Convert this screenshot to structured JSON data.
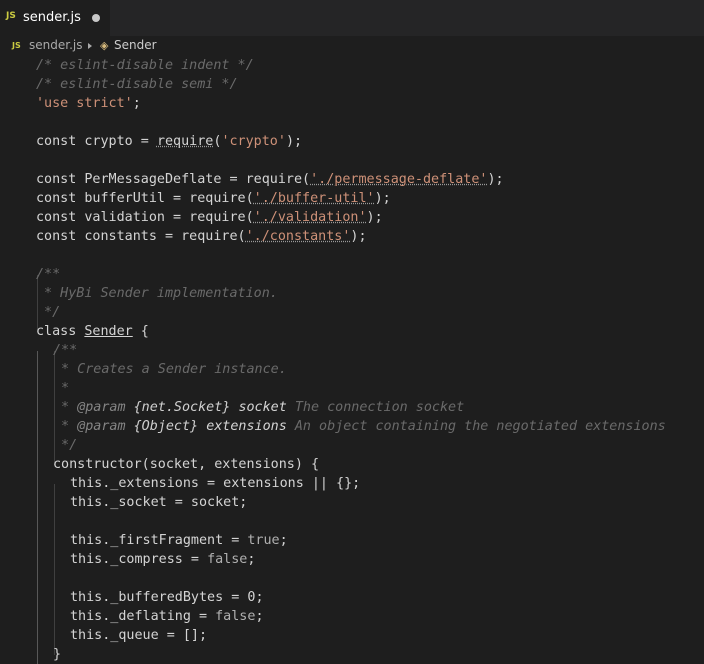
{
  "tab": {
    "icon": "JS",
    "filename": "sender.js"
  },
  "breadcrumb": {
    "icon": "JS",
    "file": "sender.js",
    "symbol_icon": "class-icon",
    "symbol": "Sender"
  },
  "code": {
    "l1": "/* eslint-disable indent */",
    "l2": "/* eslint-disable semi */",
    "l3_str": "'use strict'",
    "l5_a": "const crypto = ",
    "l5_req": "require",
    "l5_b": "(",
    "l5_str": "'crypto'",
    "l5_c": ");",
    "l7_a": "const PerMessageDeflate = require(",
    "l7_str": "'./permessage-deflate'",
    "l7_c": ");",
    "l8_a": "const bufferUtil = require(",
    "l8_str": "'./buffer-util'",
    "l8_c": ");",
    "l9_a": "const validation = require(",
    "l9_str": "'./validation'",
    "l9_c": ");",
    "l10_a": "const constants = require(",
    "l10_str": "'./constants'",
    "l10_c": ");",
    "l12": "/**",
    "l13": " * HyBi Sender implementation.",
    "l14": " */",
    "l15_a": "class ",
    "l15_name": "Sender",
    "l15_b": " {",
    "l16": "/**",
    "l17": " * Creates a Sender instance.",
    "l18": " *",
    "l19_star": " * ",
    "l19_tag": "@param",
    "l19_type": "{net.Socket}",
    "l19_name": "socket",
    "l19_desc": "The connection socket",
    "l20_star": " * ",
    "l20_tag": "@param",
    "l20_type": "{Object}",
    "l20_name": "extensions",
    "l20_desc": "An object containing the negotiated extensions",
    "l21": " */",
    "l22": "constructor(socket, extensions) {",
    "l23": "this._extensions = extensions || {};",
    "l24": "this._socket = socket;",
    "l26_a": "this._firstFragment = ",
    "l26_v": "true",
    "l26_b": ";",
    "l27_a": "this._compress = ",
    "l27_v": "false",
    "l27_b": ";",
    "l29_a": "this._bufferedBytes = ",
    "l29_v": "0",
    "l29_b": ";",
    "l30_a": "this._deflating = ",
    "l30_v": "false",
    "l30_b": ";",
    "l31": "this._queue = [];",
    "l32": "}"
  }
}
